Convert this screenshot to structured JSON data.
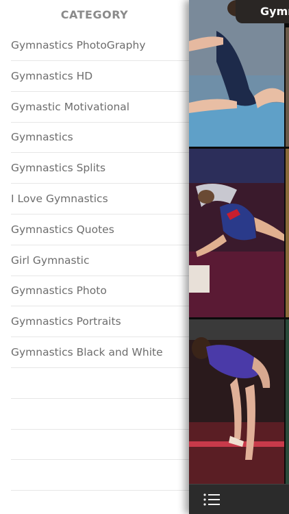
{
  "drawer": {
    "title": "CATEGORY",
    "items": [
      "Gymnastics PhotoGraphy",
      "Gymnastics HD",
      "Gymastic Motivational",
      "Gymnastics",
      "Gymnastics Splits",
      "I Love Gymnastics",
      "Gymnastics Quotes",
      "Girl Gymnastic",
      "Gymnastics Photo",
      "Gymnastics Portraits",
      "Gymnastics Black and White",
      "",
      "",
      "",
      ""
    ]
  },
  "main": {
    "title": "Gymr",
    "menu_icon": "list-icon"
  },
  "colors": {
    "drawer_title": "#8a8a8a",
    "item_text": "#6d6d6d",
    "divider": "#e6e6e6",
    "title_bar": "#2a2624",
    "bottom_bar": "#2b2b2b"
  }
}
